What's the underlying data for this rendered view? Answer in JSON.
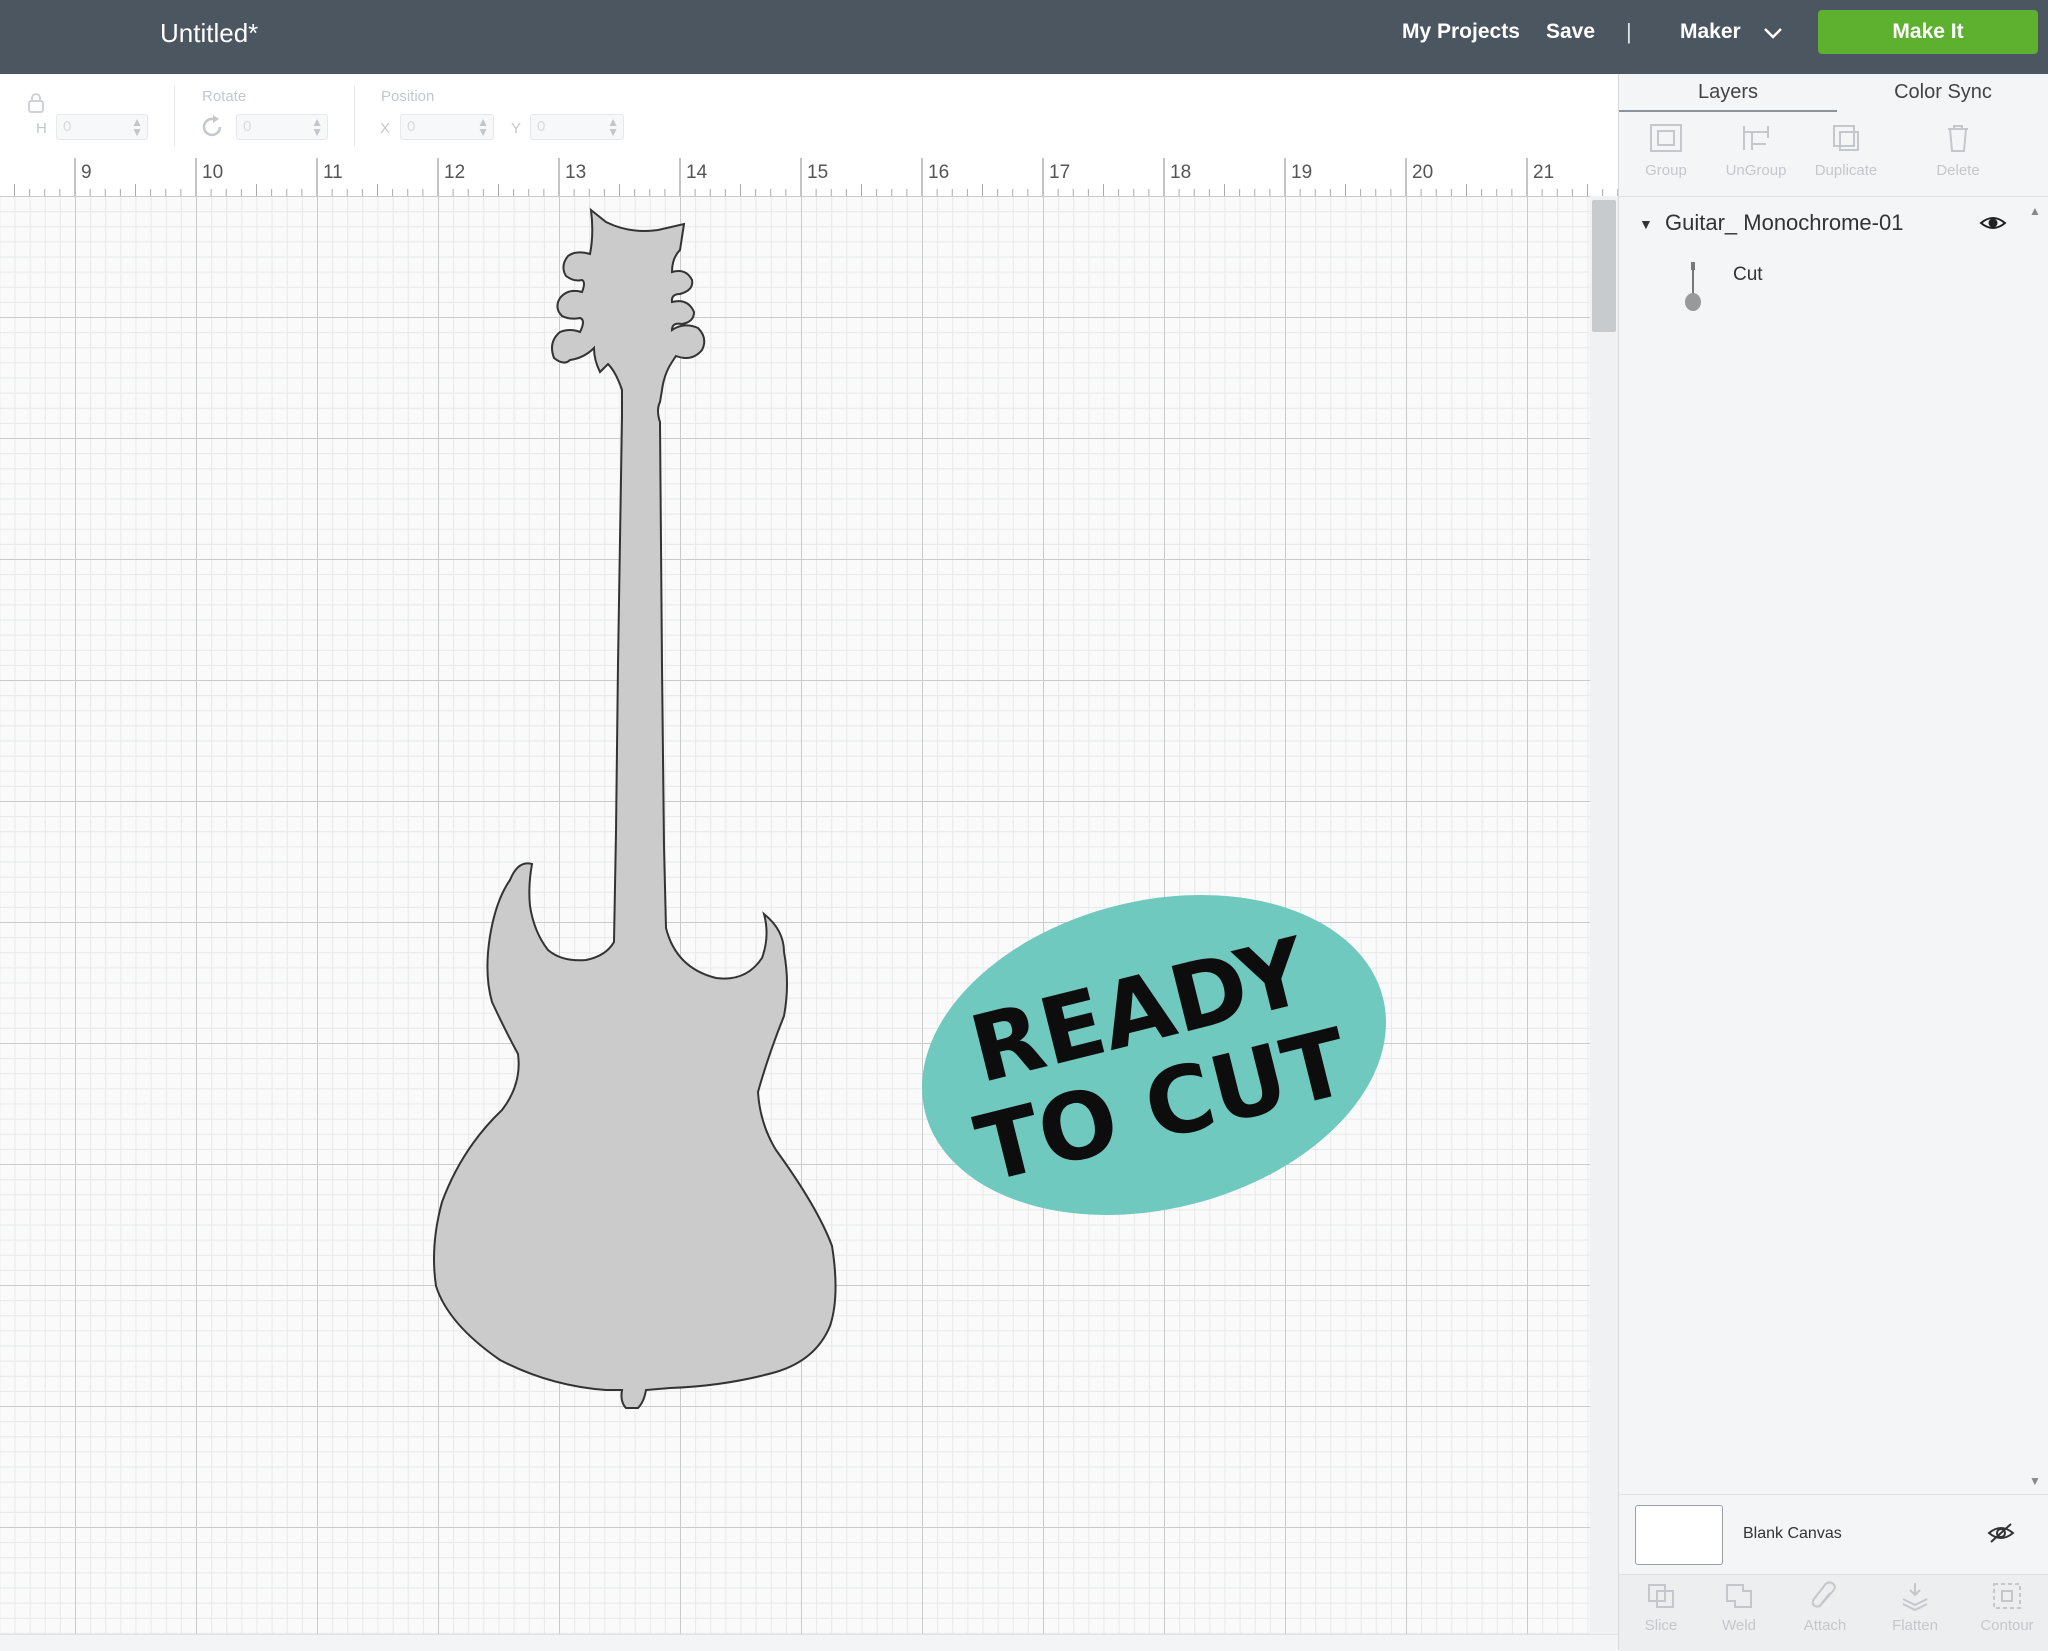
{
  "header": {
    "title": "Untitled*",
    "my_projects": "My Projects",
    "save": "Save",
    "separator": "|",
    "machine": "Maker",
    "make_it": "Make It",
    "make_it_color": "#5db12f",
    "bar_color": "#4b5661"
  },
  "toolbar": {
    "size_letter": "H",
    "size_value": "0",
    "rotate_label": "Rotate",
    "rotate_value": "0",
    "position_label": "Position",
    "x_letter": "X",
    "x_value": "0",
    "y_letter": "Y",
    "y_value": "0"
  },
  "ruler": {
    "numbers": [
      "9",
      "10",
      "11",
      "12",
      "13",
      "14",
      "15",
      "16",
      "17",
      "18",
      "19",
      "20",
      "21"
    ]
  },
  "canvas": {
    "object": "guitar",
    "object_fill": "#cbcbcb",
    "badge_line1": "READY",
    "badge_line2": "TO CUT",
    "badge_color": "#70c9bf"
  },
  "panel": {
    "tabs": [
      "Layers",
      "Color Sync"
    ],
    "tools": [
      "Group",
      "UnGroup",
      "Duplicate",
      "Delete"
    ],
    "layer_group_name": "Guitar_ Monochrome-01",
    "layer_item_operation": "Cut",
    "blank_canvas": "Blank Canvas",
    "bottom_tools": [
      "Slice",
      "Weld",
      "Attach",
      "Flatten",
      "Contour"
    ]
  }
}
